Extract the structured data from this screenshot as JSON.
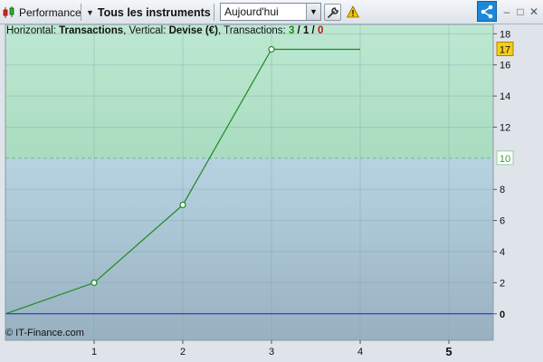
{
  "toolbar": {
    "performance_label": "Performance",
    "instruments_label": "Tous les instruments",
    "date_value": "Aujourd'hui"
  },
  "info": {
    "horizontal_label": "Horizontal: ",
    "horizontal_value": "Transactions",
    "vertical_label": ", Vertical: ",
    "vertical_value": "Devise (€)",
    "transactions_label": ", Transactions: ",
    "count_green": "3",
    "slash1": " / ",
    "count_black": "1",
    "slash2": " / ",
    "count_red": "0"
  },
  "copyright": "© IT-Finance.com",
  "colors": {
    "gain_zone": "#a9dcc0",
    "loss_zone": "#a3bfcf",
    "line": "#1c8a1c",
    "zero_line": "#1a1ad8",
    "last_badge_bg": "#f4cc1c",
    "ref_badge_text": "#3b9b3b"
  },
  "chart_data": {
    "type": "line",
    "x": [
      0,
      1,
      2,
      3
    ],
    "y": [
      0,
      2,
      7,
      17
    ],
    "final_level": {
      "from_x": 3,
      "to_x": 4,
      "y": 17
    },
    "reference_value": 10,
    "zero_value": 0,
    "xlim": [
      0,
      5.5
    ],
    "ylim": [
      -1.7,
      18.6
    ],
    "xticks": [
      "1",
      "2",
      "3",
      "4",
      "5"
    ],
    "yticks": [
      "0",
      "2",
      "4",
      "6",
      "8",
      "12",
      "14",
      "16",
      "18"
    ],
    "last_value_badge": "17",
    "reference_badge": "10",
    "grid": true
  }
}
